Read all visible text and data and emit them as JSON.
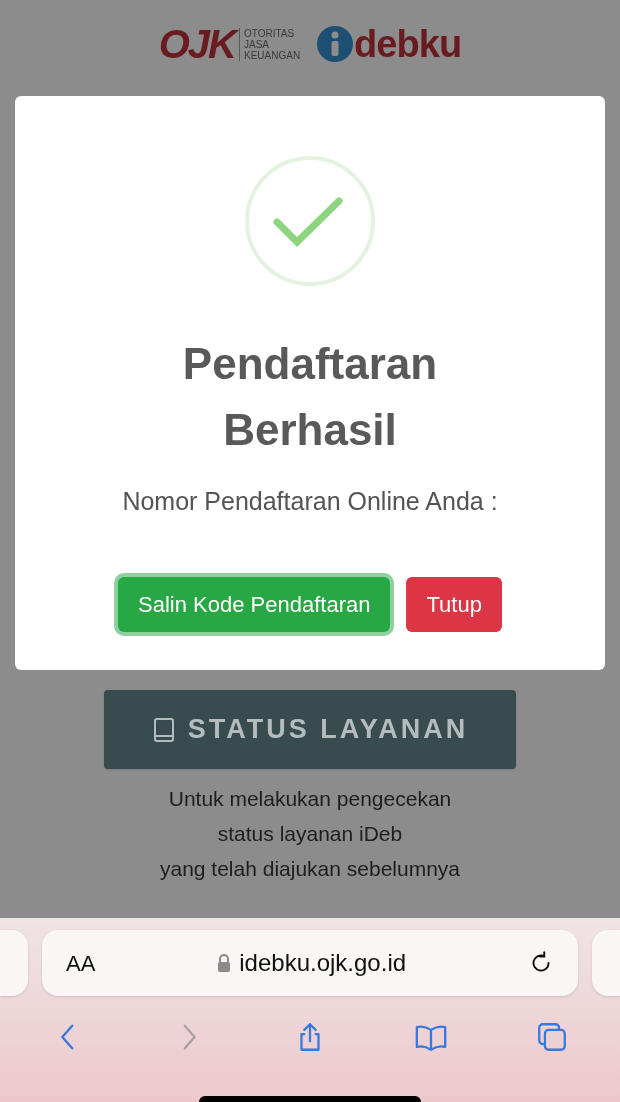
{
  "header": {
    "ojk_logo": "OJK",
    "ojk_caption": [
      "OTORITAS",
      "JASA",
      "KEUANGAN"
    ],
    "idebku_logo": "debku"
  },
  "modal": {
    "title_lines": [
      "Pendaftaran",
      "Berhasil"
    ],
    "subtitle": "Nomor Pendaftaran Online Anda :",
    "buttons": [
      {
        "label": "Salin Kode Pendaftaran",
        "kind": "primary",
        "focused": true
      },
      {
        "label": "Tutup",
        "kind": "danger",
        "focused": false
      }
    ]
  },
  "page": {
    "status_button": "STATUS LAYANAN",
    "description": [
      "Untuk melakukan pengecekan",
      "status layanan iDeb",
      "yang telah diajukan sebelumnya"
    ]
  },
  "browser": {
    "text_size": "AA",
    "url": "idebku.ojk.go.id",
    "toolbar": [
      {
        "kind": "back",
        "disabled": false
      },
      {
        "kind": "forward",
        "disabled": true
      },
      {
        "kind": "share",
        "disabled": false
      },
      {
        "kind": "bookmarks",
        "disabled": false
      },
      {
        "kind": "tabs",
        "disabled": false
      }
    ]
  }
}
